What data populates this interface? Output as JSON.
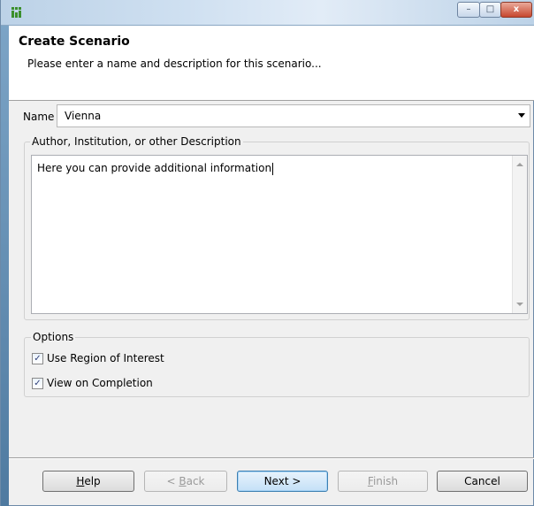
{
  "window": {
    "buttons": {
      "minimize": "–",
      "maximize": "□",
      "close": "x"
    }
  },
  "header": {
    "title": "Create Scenario",
    "subtitle": "Please enter a name and description for this scenario..."
  },
  "form": {
    "name_label": "Name",
    "name_value": "Vienna",
    "description_legend": "Author, Institution, or other Description",
    "description_text": "Here you can provide additional information"
  },
  "options": {
    "legend": "Options",
    "items": [
      {
        "label": "Use Region of Interest",
        "checked": true
      },
      {
        "label": "View on Completion",
        "checked": true
      }
    ]
  },
  "buttons": {
    "help": {
      "pre": "",
      "mnemonic": "H",
      "post": "elp"
    },
    "back": {
      "pre": "< ",
      "mnemonic": "B",
      "post": "ack"
    },
    "next": {
      "label": "Next >"
    },
    "finish": {
      "pre": "",
      "mnemonic": "F",
      "post": "inish"
    },
    "cancel": {
      "label": "Cancel"
    }
  },
  "icons": {
    "check": "✓"
  }
}
